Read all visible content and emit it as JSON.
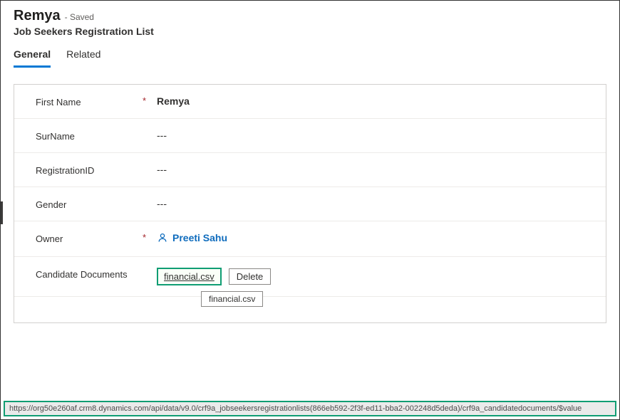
{
  "header": {
    "title": "Remya",
    "status": " - Saved",
    "subtitle": "Job Seekers Registration List"
  },
  "tabs": {
    "general": "General",
    "related": "Related"
  },
  "fields": {
    "firstName": {
      "label": "First Name",
      "value": "Remya",
      "required": "*"
    },
    "surName": {
      "label": "SurName",
      "value": "---",
      "required": ""
    },
    "regId": {
      "label": "RegistrationID",
      "value": "---",
      "required": ""
    },
    "gender": {
      "label": "Gender",
      "value": "---",
      "required": ""
    },
    "owner": {
      "label": "Owner",
      "value": "Preeti Sahu",
      "required": "*"
    },
    "candidateDocs": {
      "label": "Candidate Documents",
      "file": "financial.csv",
      "deleteLabel": "Delete",
      "required": ""
    }
  },
  "tooltip": "financial.csv",
  "urlBar": "https://org50e260af.crm8.dynamics.com/api/data/v9.0/crf9a_jobseekersregistrationlists(866eb592-2f3f-ed11-bba2-002248d5deda)/crf9a_candidatedocuments/$value"
}
